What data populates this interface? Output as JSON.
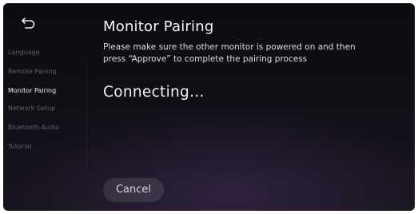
{
  "icons": {
    "back": "back-arrow-icon"
  },
  "sidebar": {
    "items": [
      {
        "label": "Language",
        "active": false
      },
      {
        "label": "Remote Pairing",
        "active": false
      },
      {
        "label": "Monitor Pairing",
        "active": true
      },
      {
        "label": "Network Setup",
        "active": false
      },
      {
        "label": "Bluetooth Audio",
        "active": false
      },
      {
        "label": "Tutorial",
        "active": false
      }
    ]
  },
  "main": {
    "title": "Monitor Pairing",
    "instructions": "Please make sure the other monitor is powered on and then press “Approve” to complete the pairing process",
    "status": "Connecting...",
    "cancel_label": "Cancel"
  },
  "colors": {
    "active_text": "#ffffff",
    "inactive_text": "#5a5a60",
    "background": "#0e0e13",
    "button_fill": "#2a2a30"
  }
}
